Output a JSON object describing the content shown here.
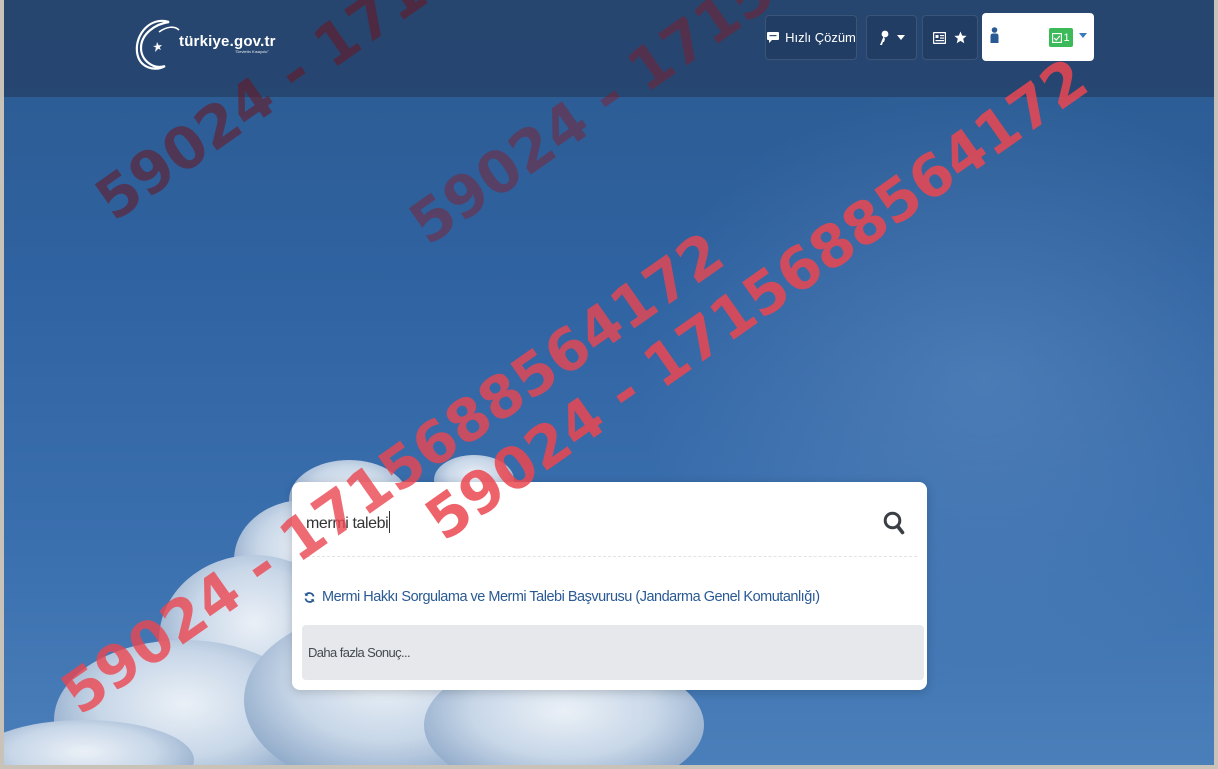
{
  "header": {
    "logo_text": "türkiye.gov.tr",
    "logo_tagline": "\"Devletin Kısayolu\"",
    "quick_solution_label": "Hızlı Çözüm",
    "message_count": "1"
  },
  "search": {
    "query": "mermi talebi",
    "results": [
      {
        "label": "Mermi Hakkı Sorgulama ve Mermi Talebi Başvurusu (Jandarma Genel Komutanlığı)"
      }
    ],
    "more_label": "Daha fazla Sonuç..."
  },
  "watermark": {
    "line1": "59024 - 1715688564172",
    "line2": "59024 - 1715688564172",
    "line3": "59024 - 1715688564172",
    "line4": "59024 - 1715688564172"
  },
  "colors": {
    "header_bg": "#243e64",
    "result_link": "#2a5a93",
    "badge": "#3cba5a",
    "watermark_dark": "#6e141e",
    "watermark_light": "#eb4650"
  }
}
